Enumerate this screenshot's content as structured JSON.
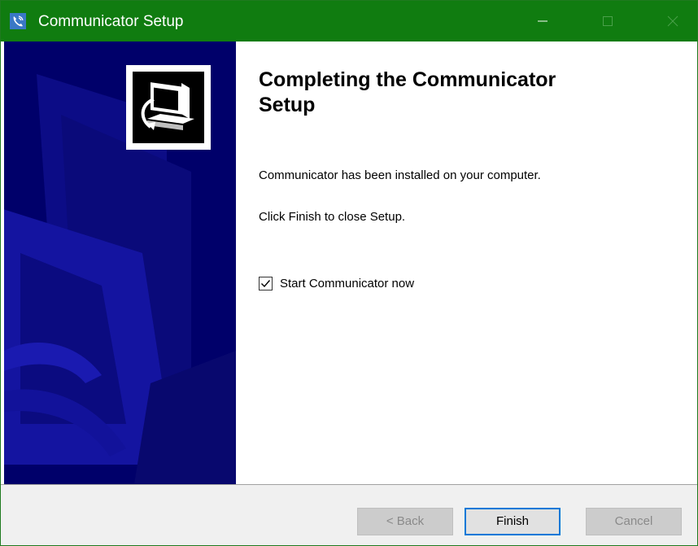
{
  "window": {
    "title": "Communicator Setup",
    "accent_color": "#107c10",
    "icon": "phone-handset-icon",
    "controls": [
      "minimize-icon",
      "maximize-icon",
      "close-icon"
    ]
  },
  "banner": {
    "background_color": "#00006a",
    "logo_icon": "computer-install-icon"
  },
  "content": {
    "heading": "Completing the Communicator Setup",
    "message_installed": "Communicator has been installed on your computer.",
    "message_finish": "Click Finish to close Setup.",
    "start_checkbox": {
      "label": "Start Communicator now",
      "checked": true
    }
  },
  "footer": {
    "back_label": "< Back",
    "finish_label": "Finish",
    "cancel_label": "Cancel",
    "back_enabled": false,
    "cancel_enabled": false
  }
}
